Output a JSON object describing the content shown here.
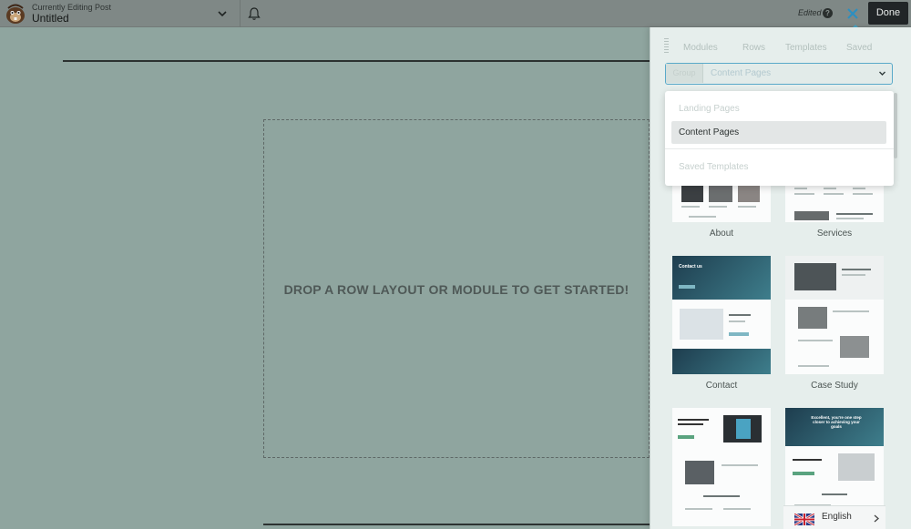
{
  "topbar": {
    "kicker": "Currently Editing Post",
    "title": "Untitled",
    "edited": "Edited",
    "help": "?",
    "done_label": "Done"
  },
  "canvas": {
    "drop_text": "DROP A ROW LAYOUT OR MODULE TO GET STARTED!"
  },
  "panel": {
    "tabs": [
      "Modules",
      "Rows",
      "Templates",
      "Saved"
    ],
    "select_group": "Group",
    "select_value": "Content Pages",
    "dropdown_options": [
      "Landing Pages",
      "Content Pages",
      "Saved Templates"
    ],
    "templates": [
      "About",
      "Services",
      "Contact",
      "Case Study"
    ],
    "card_texts": {
      "contact_heading": "Contact us",
      "excellent": "Excellent, you're one step closer to achieving your goals"
    },
    "language": "English"
  },
  "colors": {
    "accent": "#4aa3c2",
    "overlay": "#8fa59f",
    "done_bg": "#212527"
  }
}
